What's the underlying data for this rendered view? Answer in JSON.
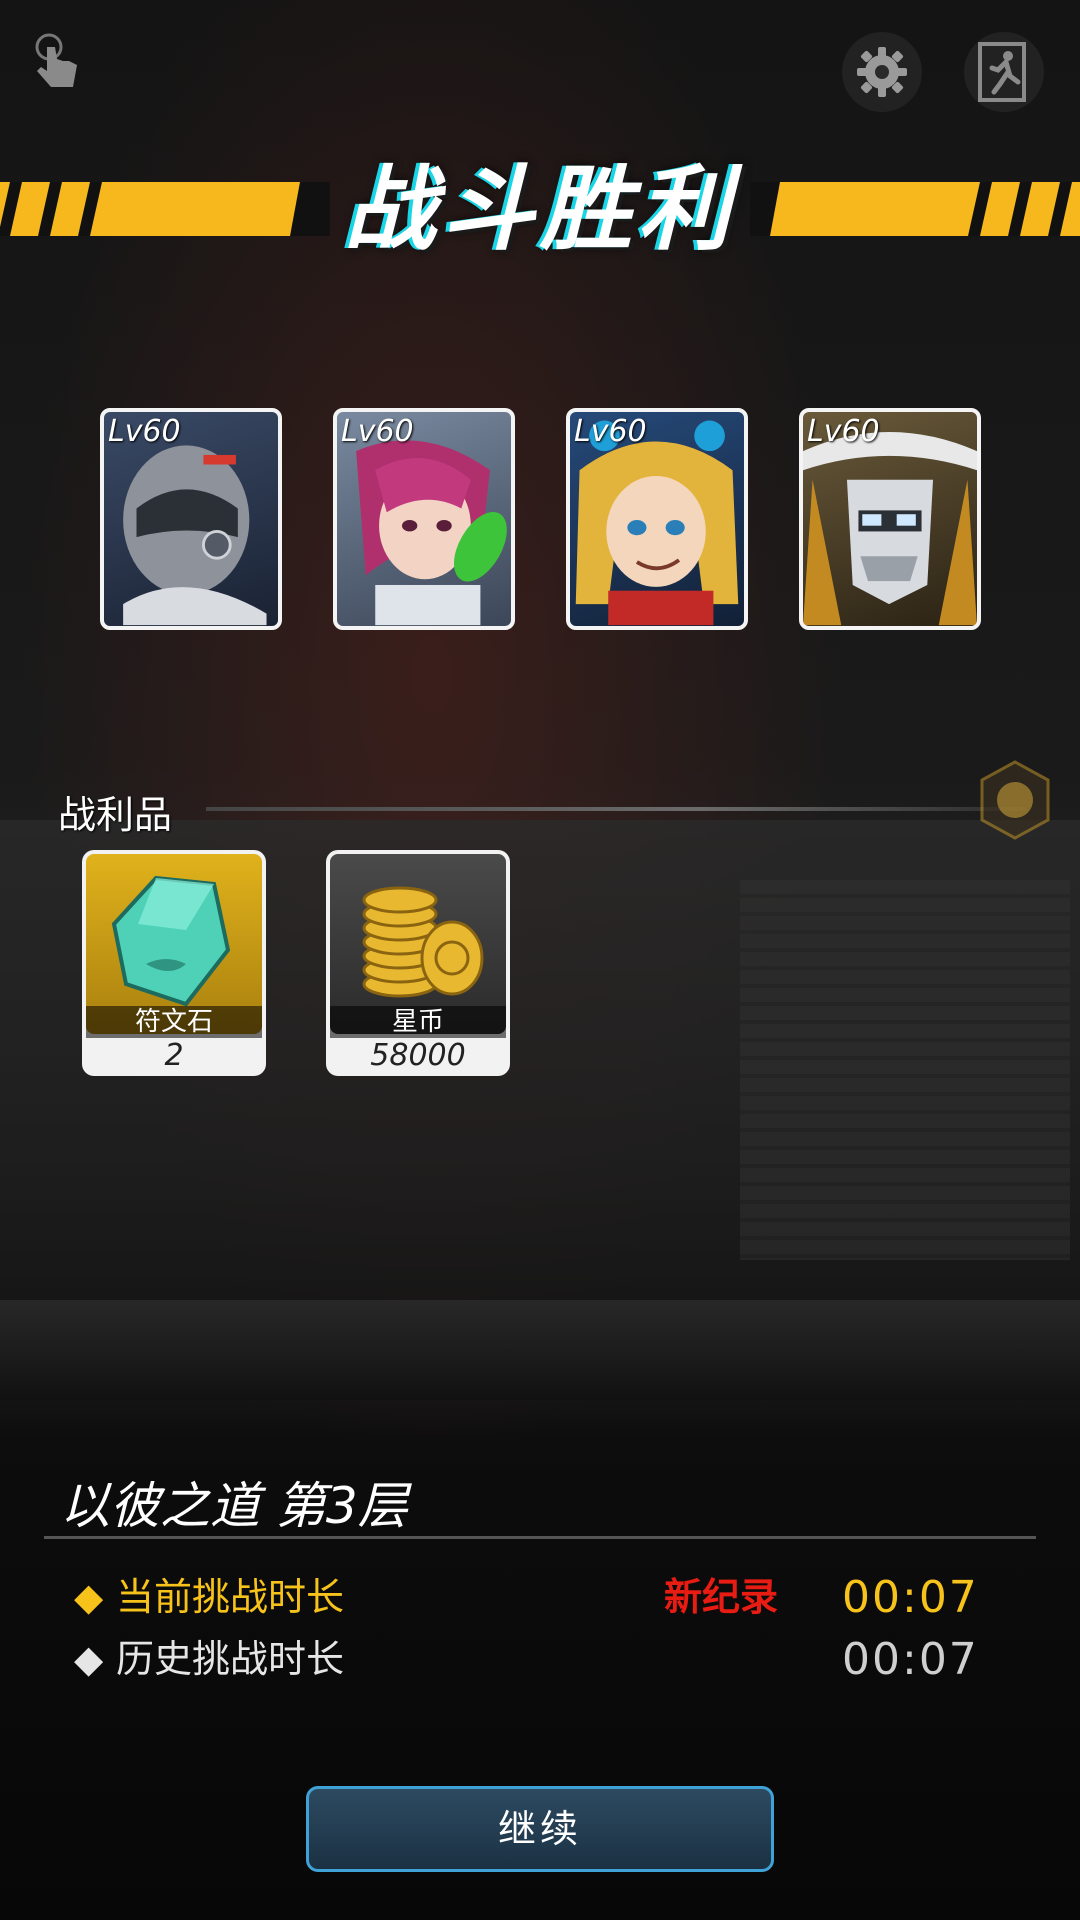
{
  "banner": {
    "title": "战斗胜利"
  },
  "heroes": [
    {
      "level": "Lv60"
    },
    {
      "level": "Lv60"
    },
    {
      "level": "Lv60"
    },
    {
      "level": "Lv60"
    }
  ],
  "loot": {
    "label": "战利品",
    "items": [
      {
        "name": "符文石",
        "count": "2"
      },
      {
        "name": "星币",
        "count": "58000"
      }
    ]
  },
  "stage": {
    "title": "以彼之道  第3层",
    "current_label": "当前挑战时长",
    "current_time": "00:07",
    "new_record": "新纪录",
    "history_label": "历史挑战时长",
    "history_time": "00:07"
  },
  "actions": {
    "continue": "继续"
  },
  "colors": {
    "accent_yellow": "#f6b81c",
    "new_record_red": "#e81c12",
    "button_border": "#3fa2d6"
  }
}
